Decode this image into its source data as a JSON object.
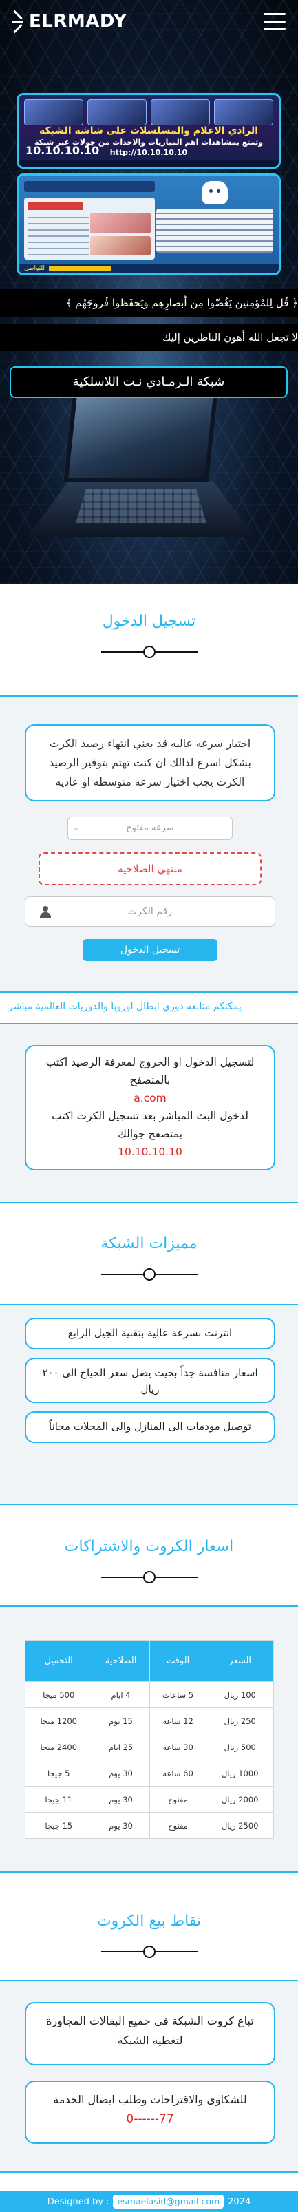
{
  "header": {
    "brand": "ELRMADY",
    "menu_icon": "hamburger-menu-icon"
  },
  "hero": {
    "banner1": {
      "title": "الرادي الاعلام والمسلسلات على شاشة الشبكة",
      "subtitle": "وتمتع بمشاهدات اهم المباريات والاحداث من جولات عبر شبكة",
      "ip": "10.10.10.10",
      "url": "http://10.10.10.10"
    },
    "banner2": {
      "footer_text": "للتواصل"
    },
    "marquee1": "﴿ قُل لِلمُؤمِنينَ يَغُضّوا مِن أَبصارِهِم وَيَحفَظوا فُروجَهُم ﴾",
    "marquee2": "لا تجعل الله أهون الناظرين إليك",
    "network_button": "شبكة الـرمـادي نـت اللاسلكية"
  },
  "login": {
    "title": "تسجيل الدخول",
    "info_text": "اختيار سرعه عاليه قد يعني انتهاء رصيد الكرت بشكل اسرع لذالك ان كنت تهتم بتوفير الرصيد الكرت يجب اختيار سرعه متوسطه او عاديه",
    "speed_select_value": "سرعه مفتوح",
    "expired_text": "منتهي الصلاحيه",
    "card_placeholder": "رقم الكرت",
    "login_button": "تسجيل الدخول",
    "scroll_text": "يمكنكم متابعه دوري ابطال اوروبا والدوريات العالمية مباشر"
  },
  "instructions": {
    "line1": "لتسجيل الدخول او الخروج لمعرفة الرصيد اكتب بالمتصفح",
    "link1": "a.com",
    "line2": "لدخول البث المباشر بعد تسجيل الكرت اكتب بمتصفح جوالك",
    "link2": "10.10.10.10"
  },
  "features": {
    "title": "مميزات الشبكة",
    "items": [
      "انترنت بسرعة عالية بتقنية الجيل الرابع",
      "اسعار منافسة جداً بحيث يصل سعر الجياج الى ٢٠٠ ريال",
      "توصيل مودمات الى المنازل والى المحلات مجاناً"
    ]
  },
  "prices": {
    "title": "اسعار الكروت والاشتراكات",
    "headers": [
      "السعر",
      "الوقت",
      "الصلاحية",
      "التحميل"
    ],
    "rows": [
      [
        "100 ريال",
        "5 ساعات",
        "4 ايام",
        "500 ميجا"
      ],
      [
        "250 ريال",
        "12 ساعه",
        "15 يوم",
        "1200 ميجا"
      ],
      [
        "500 ريال",
        "30 ساعه",
        "25 ايام",
        "2400 ميجا"
      ],
      [
        "1000 ريال",
        "60 ساعه",
        "30 يوم",
        "5 جيجا"
      ],
      [
        "2000 ريال",
        "مفتوح",
        "30 يوم",
        "11 جيجا"
      ],
      [
        "2500 ريال",
        "مفتوح",
        "30 يوم",
        "15 جيجا"
      ]
    ]
  },
  "sales": {
    "title": "نقاط بيع الكروت",
    "card1": "تباع كروت الشبكة في جميع البقالات المجاورة لتغطية الشبكة",
    "card2": "للشكاوى والاقتراحات وطلب ايصال الخدمة",
    "phone": "77------0"
  },
  "footer": {
    "designed_by": "Designed by :",
    "email": "esmaelasid@gmail.com",
    "year": "2024"
  },
  "colors": {
    "accent": "#29b6f0",
    "red": "#e0261f",
    "band": "#f0f4f7"
  }
}
